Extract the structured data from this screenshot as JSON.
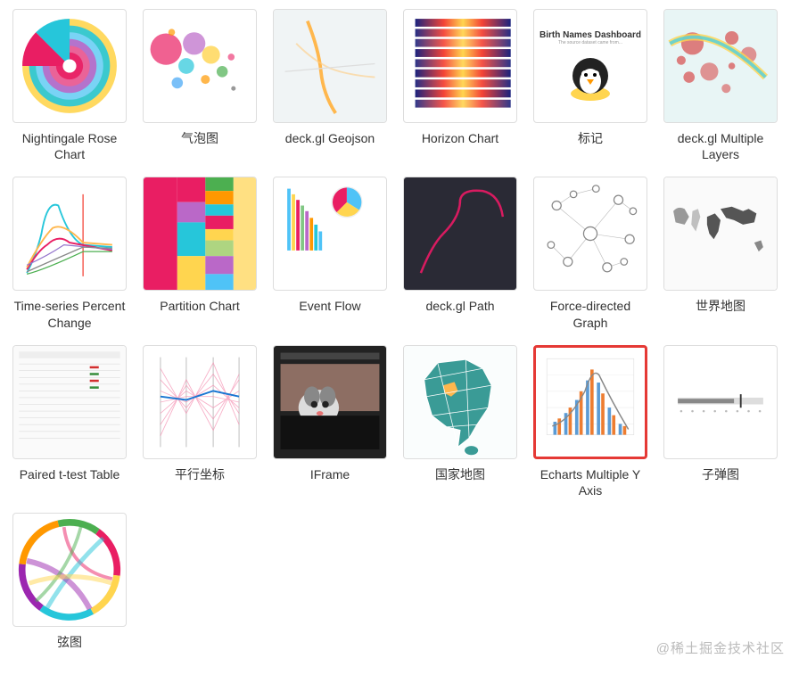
{
  "watermark": "@稀土掘金技术社区",
  "charts": [
    {
      "id": "nightingale",
      "label": "Nightingale Rose Chart",
      "highlighted": false
    },
    {
      "id": "bubble",
      "label": "气泡图",
      "highlighted": false
    },
    {
      "id": "deckgl-geojson",
      "label": "deck.gl Geojson",
      "highlighted": false
    },
    {
      "id": "horizon",
      "label": "Horizon Chart",
      "highlighted": false
    },
    {
      "id": "markup",
      "label": "标记",
      "highlighted": false
    },
    {
      "id": "deckgl-multiple",
      "label": "deck.gl Multiple Layers",
      "highlighted": false
    },
    {
      "id": "timeseries-pct",
      "label": "Time-series Percent Change",
      "highlighted": false
    },
    {
      "id": "partition",
      "label": "Partition Chart",
      "highlighted": false
    },
    {
      "id": "event-flow",
      "label": "Event Flow",
      "highlighted": false
    },
    {
      "id": "deckgl-path",
      "label": "deck.gl Path",
      "highlighted": false
    },
    {
      "id": "force-directed",
      "label": "Force-directed Graph",
      "highlighted": false
    },
    {
      "id": "world-map",
      "label": "世界地图",
      "highlighted": false
    },
    {
      "id": "paired-ttest",
      "label": "Paired t-test Table",
      "highlighted": false
    },
    {
      "id": "parallel-coords",
      "label": "平行坐标",
      "highlighted": false
    },
    {
      "id": "iframe",
      "label": "IFrame",
      "highlighted": false
    },
    {
      "id": "country-map",
      "label": "国家地图",
      "highlighted": false
    },
    {
      "id": "echarts-multi-y",
      "label": "Echarts Multiple Y Axis",
      "highlighted": true
    },
    {
      "id": "bullet",
      "label": "子弹图",
      "highlighted": false
    },
    {
      "id": "chord",
      "label": "弦图",
      "highlighted": false
    }
  ],
  "markup_card": {
    "title": "Birth Names Dashboard",
    "subtitle": "The source dataset came from..."
  },
  "colors": {
    "highlight": "#e53935",
    "teal": "#3a9b96",
    "pink": "#e91e63",
    "cyan": "#26c6da",
    "yellow": "#ffd54f",
    "purple": "#9c27b0",
    "orange": "#ff9800",
    "red": "#f44336",
    "blue": "#2196f3",
    "navy": "#1a237e"
  }
}
